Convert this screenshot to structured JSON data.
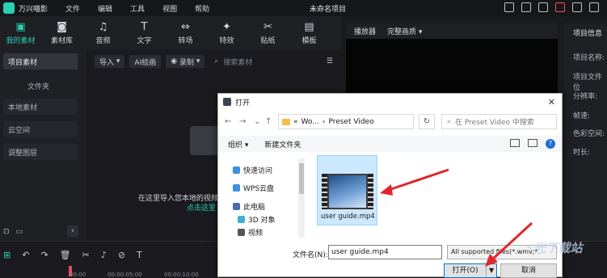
{
  "app": {
    "name": "万兴喵影",
    "menu": [
      "文件",
      "编辑",
      "工具",
      "视图",
      "帮助"
    ],
    "document_title": "未命名项目"
  },
  "toolbar": [
    {
      "label": "我的素材",
      "icon": "folder-media-icon",
      "active": true
    },
    {
      "label": "素材库",
      "icon": "library-icon"
    },
    {
      "label": "音频",
      "icon": "music-icon"
    },
    {
      "label": "文字",
      "icon": "text-icon"
    },
    {
      "label": "转场",
      "icon": "transition-icon"
    },
    {
      "label": "特效",
      "icon": "effects-icon"
    },
    {
      "label": "贴纸",
      "icon": "sticker-icon"
    },
    {
      "label": "模板",
      "icon": "template-icon"
    }
  ],
  "sidebar": {
    "items": [
      {
        "label": "项目素材",
        "active": true
      },
      {
        "label": "文件夹",
        "sub": true
      },
      {
        "label": "本地素材"
      },
      {
        "label": "云空间"
      },
      {
        "label": "调整图层"
      }
    ]
  },
  "media_toolbar": {
    "import_label": "导入",
    "ai_label": "AI绘画",
    "record_label": "录制",
    "search_placeholder": "搜索素材"
  },
  "media_empty": {
    "hint": "在这里导入您本地的视频、",
    "link": "点击这里"
  },
  "player": {
    "tab_player": "播放器",
    "tab_quality": "完整画质"
  },
  "right_panel": {
    "title": "项目信息",
    "labels": [
      "项目名称:",
      "项目文件位",
      "分辨率:",
      "帧速:",
      "色彩空间:",
      "时长:"
    ]
  },
  "timeline": {
    "times": [
      "00:00",
      "00:00:05:00",
      "00:00:10:00"
    ]
  },
  "dialog": {
    "title": "打开",
    "path": [
      "«",
      "Wo...",
      "›",
      "Preset Video"
    ],
    "search_placeholder": "在 Preset Video 中搜索",
    "organize": "组织 ▾",
    "new_folder": "新建文件夹",
    "nav": [
      {
        "label": "快速访问",
        "color": "#3d8fe0"
      },
      {
        "label": "WPS云盘",
        "color": "#3d8fe0"
      },
      {
        "label": "此电脑",
        "color": "#4a6ea8"
      },
      {
        "label": "3D 对象",
        "color": "#3fb1d8"
      },
      {
        "label": "视频",
        "color": "#555555"
      }
    ],
    "file": {
      "name": "user guide.mp4"
    },
    "filename_label": "文件名(N):",
    "filename_value": "user guide.mp4",
    "filetype_value": "All supported files(*.wmv;*.",
    "open_label": "打开(O)",
    "cancel_label": "取消"
  },
  "colors": {
    "accent": "#2ad1b4",
    "arrow": "#e3252e"
  },
  "watermark": "极光下载站"
}
